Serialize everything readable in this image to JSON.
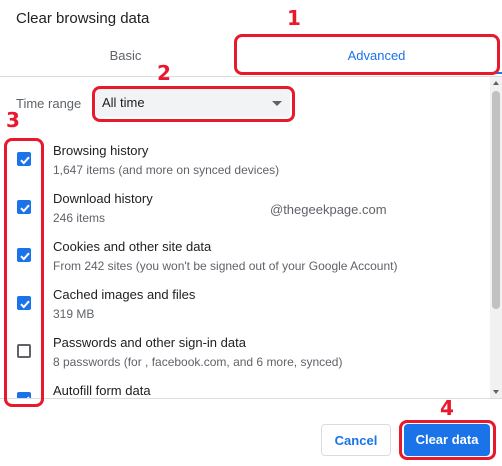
{
  "dialog": {
    "title": "Clear browsing data"
  },
  "tabs": [
    {
      "label": "Basic"
    },
    {
      "label": "Advanced",
      "active": true
    }
  ],
  "time_range": {
    "label": "Time range",
    "selected": "All time"
  },
  "items": [
    {
      "title": "Browsing history",
      "subtitle": "1,647 items (and more on synced devices)",
      "checked": true
    },
    {
      "title": "Download history",
      "subtitle": "246 items",
      "checked": true
    },
    {
      "title": "Cookies and other site data",
      "subtitle": "From 242 sites (you won't be signed out of your Google Account)",
      "checked": true
    },
    {
      "title": "Cached images and files",
      "subtitle": "319 MB",
      "checked": true
    },
    {
      "title": "Passwords and other sign-in data",
      "subtitle": "8 passwords (for , facebook.com, and 6 more, synced)",
      "checked": false
    },
    {
      "title": "Autofill form data",
      "subtitle": "",
      "checked": true
    }
  ],
  "watermark": "@thegeekpage.com",
  "buttons": {
    "cancel": "Cancel",
    "clear": "Clear data"
  },
  "annotations": [
    "1",
    "2",
    "3",
    "4"
  ],
  "colors": {
    "accent": "#1a73e8",
    "annotation": "#e8192c"
  }
}
